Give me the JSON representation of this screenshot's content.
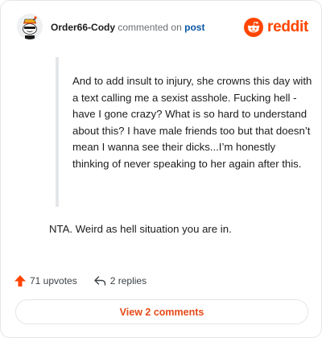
{
  "header": {
    "username": "Order66-Cody",
    "action_text": "commented on",
    "post_link": "post",
    "brand": "reddit"
  },
  "quote": {
    "text": "And to add insult to injury, she crowns this day with a text calling me a sexist asshole. Fucking hell - have I gone crazy? What is so hard to understand about this? I have male friends too but that doesn’t mean I wanna see their dicks...I’m honestly thinking of never speaking to her again after this."
  },
  "comment": {
    "text": "NTA. Weird as hell situation you are in."
  },
  "actions": {
    "upvotes": "71 upvotes",
    "replies": "2 replies"
  },
  "footer": {
    "view_comments": "View 2 comments"
  },
  "colors": {
    "brand_orange": "#ff4500",
    "link_blue": "#0b57a4",
    "view_button_text": "#e64a19"
  },
  "icons": {
    "avatar": "snoo-avatar-icon",
    "brand": "reddit-logo-icon",
    "upvote": "upvote-arrow-icon",
    "reply": "reply-arrow-icon"
  }
}
